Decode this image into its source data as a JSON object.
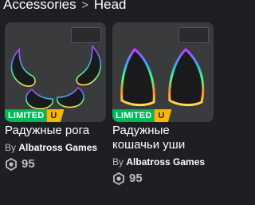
{
  "breadcrumb": {
    "parent": "Accessories",
    "separator": ">",
    "current": "Head"
  },
  "items": [
    {
      "name": "Радужные рога",
      "by_label": "By",
      "creator": "Albatross Games",
      "price": "95",
      "limited_label": "LIMITED",
      "limited_u": "U",
      "icon": "rainbow-horns-image"
    },
    {
      "name": "Радужные кошачьи уши",
      "by_label": "By",
      "creator": "Albatross Games",
      "price": "95",
      "limited_label": "LIMITED",
      "limited_u": "U",
      "icon": "rainbow-cat-ears-image"
    }
  ],
  "colors": {
    "background": "#1e1f22",
    "card": "#393b3d",
    "limited": "#02b757",
    "unique": "#f6b702",
    "secondary_text": "#bdbebe"
  }
}
